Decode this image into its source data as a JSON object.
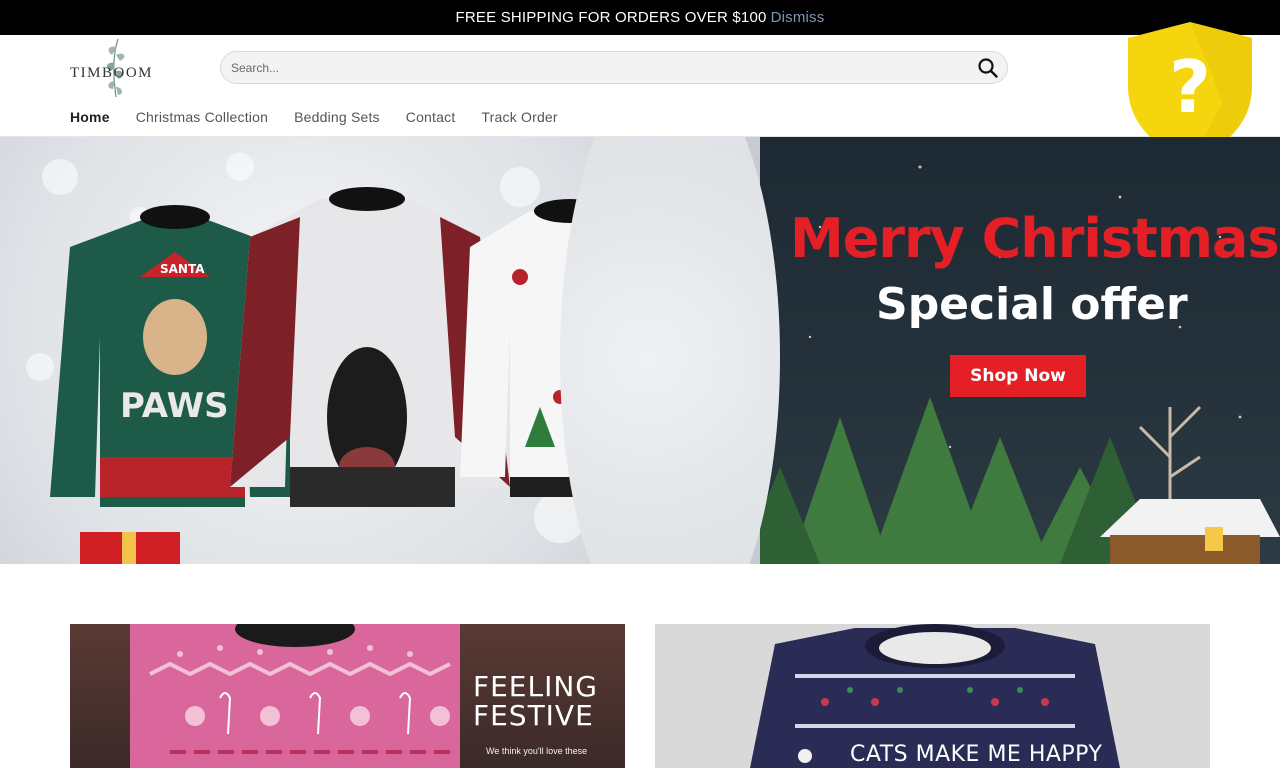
{
  "announcement": {
    "text": "FREE SHIPPING FOR ORDERS OVER $100",
    "dismiss_label": "Dismiss"
  },
  "header": {
    "logo_text": "TIMBOOM",
    "search": {
      "placeholder": "Search..."
    },
    "badge_glyph": "?"
  },
  "nav": {
    "items": [
      {
        "label": "Home"
      },
      {
        "label": "Christmas Collection"
      },
      {
        "label": "Bedding Sets"
      },
      {
        "label": "Contact"
      },
      {
        "label": "Track Order"
      }
    ]
  },
  "hero": {
    "title": "Merry Christmas",
    "subtitle": "Special offer",
    "cta_label": "Shop Now",
    "sweater_label": "PAWS",
    "hat_label": "SANTA"
  },
  "cards": [
    {
      "title_line1": "FEELING",
      "title_line2": "FESTIVE",
      "subtitle": "We think you'll love these"
    },
    {
      "sweater_text": "CATS MAKE ME HAPPY"
    }
  ],
  "colors": {
    "accent_red": "#e41f26",
    "topbar_bg": "#000000",
    "dismiss_link": "#7f96b5",
    "badge_yellow": "#f5d60e"
  }
}
